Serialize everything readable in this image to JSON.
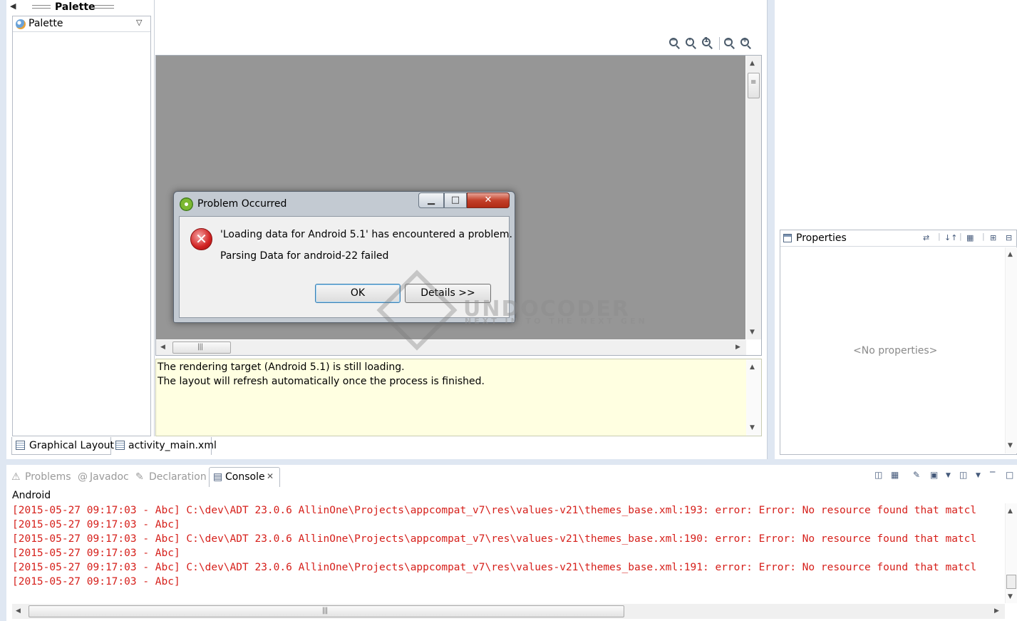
{
  "palette": {
    "header_title": "Palette",
    "dropdown_label": "Palette"
  },
  "zoom_toolbar": {
    "icons": [
      "zoom-out-icon",
      "zoom-fit-icon",
      "zoom-actual-icon",
      "zoom-out-alt-icon",
      "zoom-in-icon"
    ]
  },
  "editor": {
    "message_lines": [
      "The rendering target (Android 5.1) is still loading.",
      "The layout will refresh automatically once the process is finished."
    ],
    "tabs": [
      {
        "label": "Graphical Layout",
        "active": true
      },
      {
        "label": "activity_main.xml",
        "active": false
      }
    ]
  },
  "dialog": {
    "title": "Problem Occurred",
    "message": "'Loading data for Android 5.1' has encountered a problem.",
    "detail": "Parsing Data for android-22 failed",
    "ok_label": "OK",
    "details_label": "Details >>",
    "window_buttons": {
      "minimize": "▁",
      "maximize": "□",
      "close": "✕"
    }
  },
  "watermark": {
    "text": "UNDOCODER",
    "tagline": "NEXT IN TO THE NEXT GEN"
  },
  "properties": {
    "title": "Properties",
    "empty_text": "<No properties>"
  },
  "bottom_tabs": [
    {
      "label": "Problems",
      "icon": "problems-icon",
      "active": false
    },
    {
      "label": "Javadoc",
      "icon": "at-icon",
      "active": false
    },
    {
      "label": "Declaration",
      "icon": "declaration-icon",
      "active": false
    },
    {
      "label": "Console",
      "icon": "console-icon",
      "active": true
    }
  ],
  "console": {
    "name": "Android",
    "lines": [
      "[2015-05-27 09:17:03 - Abc] C:\\dev\\ADT 23.0.6 AllinOne\\Projects\\appcompat_v7\\res\\values-v21\\themes_base.xml:193: error: Error: No resource found that matcl",
      "[2015-05-27 09:17:03 - Abc]",
      "[2015-05-27 09:17:03 - Abc] C:\\dev\\ADT 23.0.6 AllinOne\\Projects\\appcompat_v7\\res\\values-v21\\themes_base.xml:190: error: Error: No resource found that matcl",
      "[2015-05-27 09:17:03 - Abc]",
      "[2015-05-27 09:17:03 - Abc] C:\\dev\\ADT 23.0.6 AllinOne\\Projects\\appcompat_v7\\res\\values-v21\\themes_base.xml:191: error: Error: No resource found that matcl",
      "[2015-05-27 09:17:03 - Abc]"
    ],
    "text_color": "#d6201b"
  },
  "colors": {
    "canvas": "#969696",
    "message_bg": "#ffffe1",
    "error_red": "#d6201b"
  }
}
